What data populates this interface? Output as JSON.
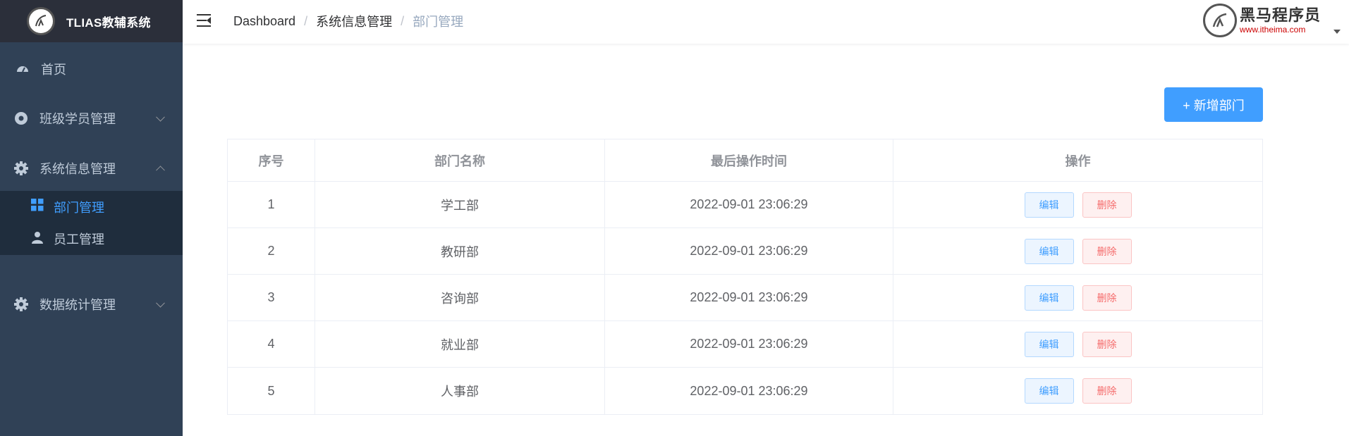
{
  "sidebar": {
    "logo_title": "TLIAS教辅系统",
    "items": [
      {
        "label": "首页",
        "icon": "dashboard-icon"
      },
      {
        "label": "班级学员管理",
        "icon": "help-circle-icon"
      },
      {
        "label": "系统信息管理",
        "icon": "gear-icon"
      },
      {
        "label": "数据统计管理",
        "icon": "gear-icon"
      }
    ],
    "submenu": [
      {
        "label": "部门管理",
        "icon": "grid-icon"
      },
      {
        "label": "员工管理",
        "icon": "user-icon"
      }
    ]
  },
  "header": {
    "breadcrumb": [
      "Dashboard",
      "系统信息管理",
      "部门管理"
    ],
    "brand_name": "黑马程序员",
    "brand_url": "www.itheima.com"
  },
  "toolbar": {
    "add_label": "+ 新增部门"
  },
  "table": {
    "headers": [
      "序号",
      "部门名称",
      "最后操作时间",
      "操作"
    ],
    "rows": [
      {
        "index": "1",
        "name": "学工部",
        "time": "2022-09-01 23:06:29"
      },
      {
        "index": "2",
        "name": "教研部",
        "time": "2022-09-01 23:06:29"
      },
      {
        "index": "3",
        "name": "咨询部",
        "time": "2022-09-01 23:06:29"
      },
      {
        "index": "4",
        "name": "就业部",
        "time": "2022-09-01 23:06:29"
      },
      {
        "index": "5",
        "name": "人事部",
        "time": "2022-09-01 23:06:29"
      }
    ],
    "edit_label": "编辑",
    "delete_label": "删除"
  },
  "colors": {
    "accent": "#409eff",
    "sidebar_bg": "#304156",
    "danger": "#f56c6c"
  }
}
